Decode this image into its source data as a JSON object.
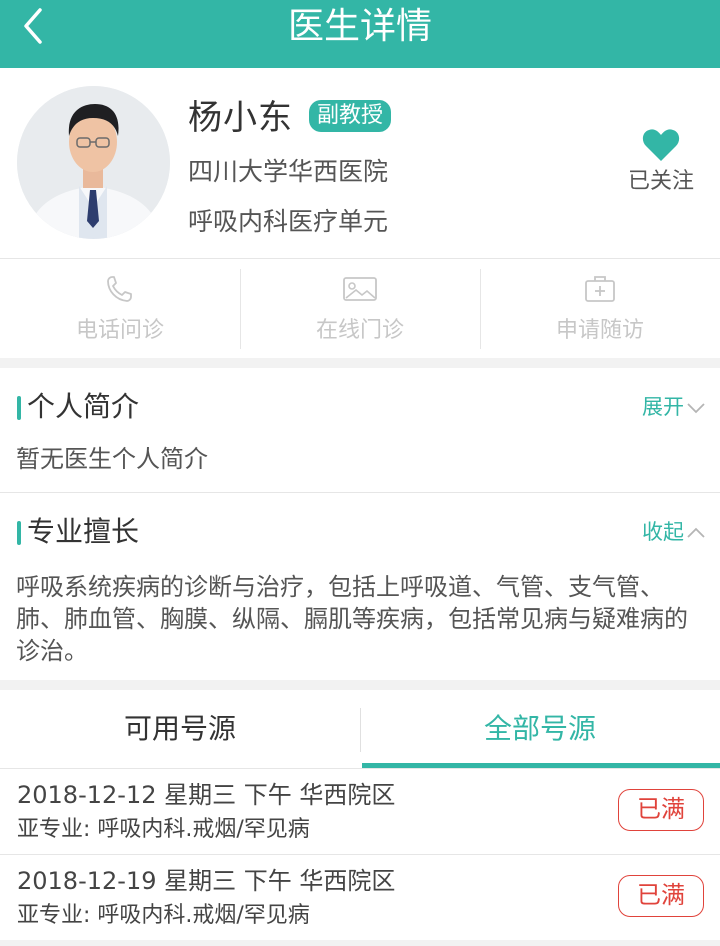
{
  "header": {
    "title": "医生详情",
    "bg_color": "#33b6a6"
  },
  "doctor": {
    "name": "杨小东",
    "title": "副教授",
    "hospital": "四川大学华西医院",
    "department": "呼吸内科医疗单元",
    "follow_label": "已关注"
  },
  "actions": [
    {
      "label": "电话问诊",
      "icon": "phone-icon"
    },
    {
      "label": "在线门诊",
      "icon": "image-icon"
    },
    {
      "label": "申请随访",
      "icon": "medical-kit-icon"
    }
  ],
  "intro": {
    "title": "个人简介",
    "toggle": "展开",
    "body": "暂无医生个人简介"
  },
  "expertise": {
    "title": "专业擅长",
    "toggle": "收起",
    "body": "呼吸系统疾病的诊断与治疗，包括上呼吸道、气管、支气管、肺、肺血管、胸膜、纵隔、膈肌等疾病，包括常见病与疑难病的诊治。"
  },
  "tabs": {
    "available": "可用号源",
    "all": "全部号源",
    "active": "all"
  },
  "slots": [
    {
      "line1": "2018-12-12 星期三 下午 华西院区",
      "line2": "亚专业: 呼吸内科.戒烟/罕见病",
      "status": "已满"
    },
    {
      "line1": "2018-12-19 星期三 下午 华西院区",
      "line2": "亚专业: 呼吸内科.戒烟/罕见病",
      "status": "已满"
    }
  ],
  "colors": {
    "accent": "#33b6a6",
    "full_status": "#e0433b",
    "disabled_text": "#c7c7c7"
  }
}
